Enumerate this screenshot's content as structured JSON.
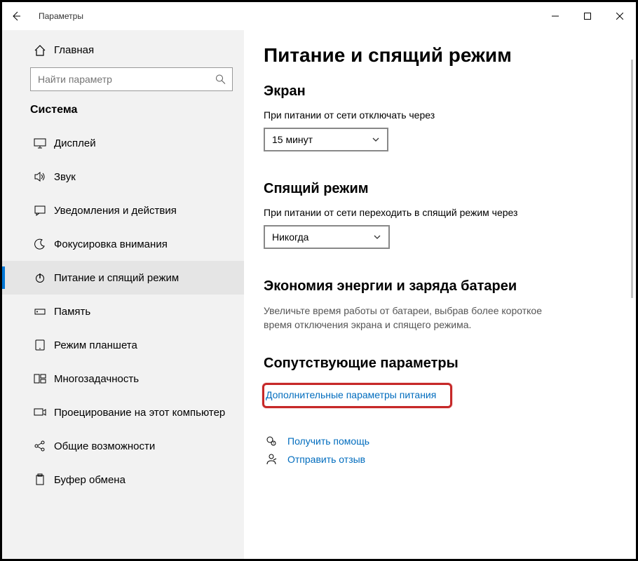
{
  "window": {
    "title": "Параметры"
  },
  "sidebar": {
    "home": "Главная",
    "search_placeholder": "Найти параметр",
    "section": "Система",
    "items": [
      {
        "label": "Дисплей"
      },
      {
        "label": "Звук"
      },
      {
        "label": "Уведомления и действия"
      },
      {
        "label": "Фокусировка внимания"
      },
      {
        "label": "Питание и спящий режим"
      },
      {
        "label": "Память"
      },
      {
        "label": "Режим планшета"
      },
      {
        "label": "Многозадачность"
      },
      {
        "label": "Проецирование на этот компьютер"
      },
      {
        "label": "Общие возможности"
      },
      {
        "label": "Буфер обмена"
      }
    ]
  },
  "main": {
    "title": "Питание и спящий режим",
    "screen": {
      "heading": "Экран",
      "label": "При питании от сети отключать через",
      "value": "15 минут"
    },
    "sleep": {
      "heading": "Спящий режим",
      "label": "При питании от сети переходить в спящий режим через",
      "value": "Никогда"
    },
    "battery": {
      "heading": "Экономия энергии и заряда батареи",
      "desc": "Увеличьте время работы от батареи, выбрав более короткое время отключения экрана и спящего режима."
    },
    "related": {
      "heading": "Сопутствующие параметры",
      "link": "Дополнительные параметры питания"
    },
    "footer": {
      "help": "Получить помощь",
      "feedback": "Отправить отзыв"
    }
  }
}
